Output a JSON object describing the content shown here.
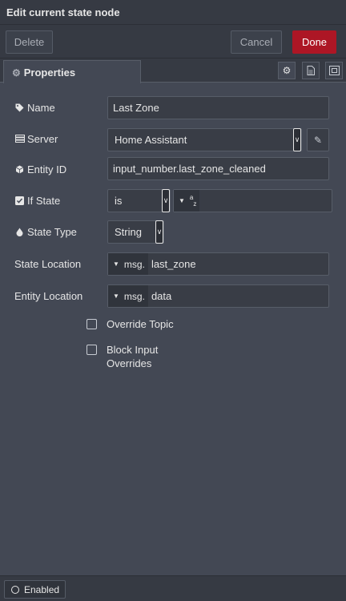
{
  "dialog": {
    "title": "Edit current state node",
    "buttons": {
      "delete": "Delete",
      "cancel": "Cancel",
      "done": "Done"
    }
  },
  "tabs": {
    "properties": "Properties"
  },
  "fields": {
    "name": {
      "label": "Name",
      "value": "Last Zone"
    },
    "server": {
      "label": "Server",
      "value": "Home Assistant"
    },
    "entity_id": {
      "label": "Entity ID",
      "value": "input_number.last_zone_cleaned"
    },
    "if_state": {
      "label": "If State",
      "operator": "is",
      "type_label": "az",
      "value": ""
    },
    "state_type": {
      "label": "State Type",
      "value": "String"
    },
    "state_location": {
      "label": "State Location",
      "prefix": "msg.",
      "value": "last_zone"
    },
    "entity_location": {
      "label": "Entity Location",
      "prefix": "msg.",
      "value": "data"
    }
  },
  "checkboxes": {
    "override_topic": {
      "label": "Override Topic",
      "checked": false
    },
    "block_input": {
      "label_line1": "Block Input",
      "label_line2": "Overrides",
      "checked": false
    }
  },
  "footer": {
    "enabled_label": "Enabled"
  },
  "colors": {
    "done_button": "#ad1625",
    "panel": "#434854",
    "bar": "#363a43"
  }
}
